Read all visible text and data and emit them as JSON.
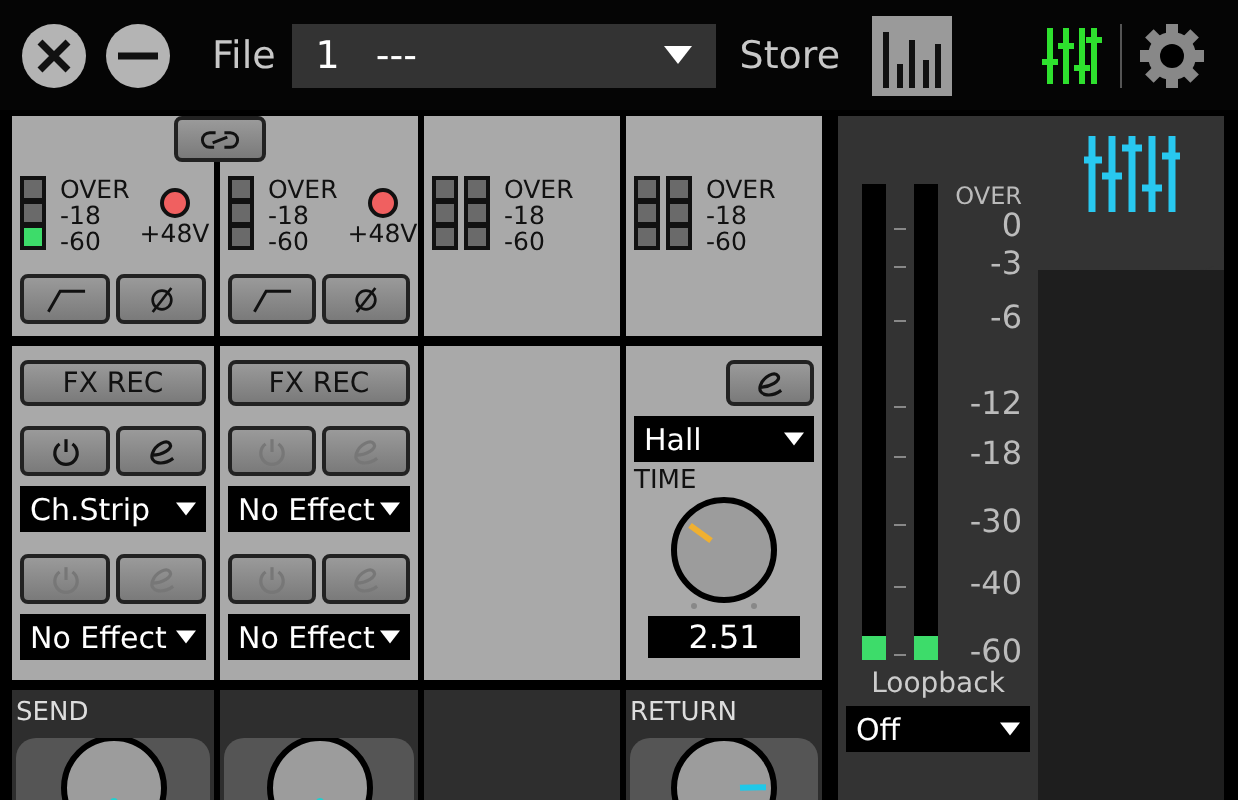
{
  "toolbar": {
    "file_label": "File",
    "file_number": "1",
    "file_name": "---",
    "store_label": "Store"
  },
  "inputs": [
    {
      "kind": "mic",
      "meters": [
        [
          {
            "lit": false
          },
          {
            "lit": false
          },
          {
            "lit": true
          }
        ]
      ],
      "meter_labels": [
        "OVER",
        "-18",
        "-60"
      ],
      "phantom_label": "+48V",
      "phantom_on": true
    },
    {
      "kind": "mic",
      "meters": [
        [
          {
            "lit": false
          },
          {
            "lit": false
          },
          {
            "lit": false
          }
        ]
      ],
      "meter_labels": [
        "OVER",
        "-18",
        "-60"
      ],
      "phantom_label": "+48V",
      "phantom_on": true
    },
    {
      "kind": "line",
      "meters": [
        [
          {
            "lit": false
          },
          {
            "lit": false
          },
          {
            "lit": false
          }
        ],
        [
          {
            "lit": false
          },
          {
            "lit": false
          },
          {
            "lit": false
          }
        ]
      ],
      "meter_labels": [
        "OVER",
        "-18",
        "-60"
      ]
    },
    {
      "kind": "line",
      "meters": [
        [
          {
            "lit": false
          },
          {
            "lit": false
          },
          {
            "lit": false
          }
        ],
        [
          {
            "lit": false
          },
          {
            "lit": false
          },
          {
            "lit": false
          }
        ]
      ],
      "meter_labels": [
        "OVER",
        "-18",
        "-60"
      ]
    }
  ],
  "effect_strips": [
    {
      "kind": "insert",
      "fx_rec": "FX REC",
      "slots": [
        {
          "effect": "Ch.Strip",
          "enabled": true
        },
        {
          "effect": "No Effect",
          "enabled": false
        }
      ]
    },
    {
      "kind": "insert",
      "fx_rec": "FX REC",
      "slots": [
        {
          "effect": "No Effect",
          "enabled": false
        },
        {
          "effect": "No Effect",
          "enabled": false
        }
      ]
    },
    {
      "kind": "empty"
    },
    {
      "kind": "reverb",
      "type": "Hall",
      "param_label": "TIME",
      "level": 0.3,
      "value": "2.51"
    }
  ],
  "sends": [
    {
      "kind": "send",
      "label": "SEND"
    },
    {
      "kind": "send"
    },
    {
      "kind": "empty"
    },
    {
      "kind": "return",
      "label": "RETURN",
      "level": 0.83
    }
  ],
  "master": {
    "scale": [
      "OVER",
      "0",
      "-3",
      "-6",
      "-12",
      "-18",
      "-30",
      "-40",
      "-60"
    ],
    "meters": [
      {
        "level": 0.05
      },
      {
        "level": 0.05
      }
    ],
    "label": "Loopback",
    "output": "Off"
  }
}
